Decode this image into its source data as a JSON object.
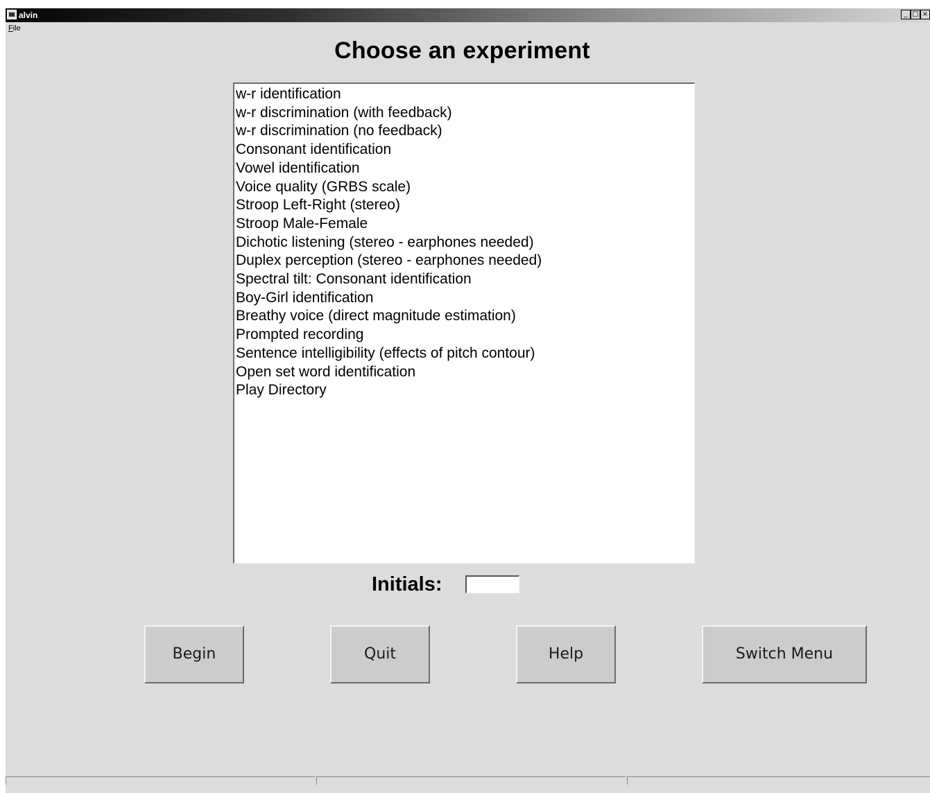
{
  "window": {
    "title": "alvin",
    "controls": [
      "_",
      "□",
      "×"
    ]
  },
  "menu": {
    "file_label": "File",
    "file_mnemonic": "F",
    "file_rest": "ile"
  },
  "main": {
    "heading": "Choose an experiment",
    "experiments": [
      "w-r identification",
      "w-r discrimination (with feedback)",
      "w-r discrimination (no feedback)",
      "Consonant identification",
      "Vowel identification",
      "Voice quality (GRBS scale)",
      "Stroop Left-Right (stereo)",
      "Stroop Male-Female",
      "Dichotic listening (stereo - earphones needed)",
      "Duplex perception (stereo - earphones needed)",
      "Spectral tilt: Consonant identification",
      "Boy-Girl identification",
      "Breathy voice (direct magnitude estimation)",
      "Prompted recording",
      "Sentence intelligibility (effects of pitch contour)",
      "Open set word identification",
      "Play Directory"
    ],
    "initials_label": "Initials:",
    "initials_value": ""
  },
  "buttons": {
    "begin": "Begin",
    "quit": "Quit",
    "help": "Help",
    "switch_menu": "Switch Menu"
  }
}
